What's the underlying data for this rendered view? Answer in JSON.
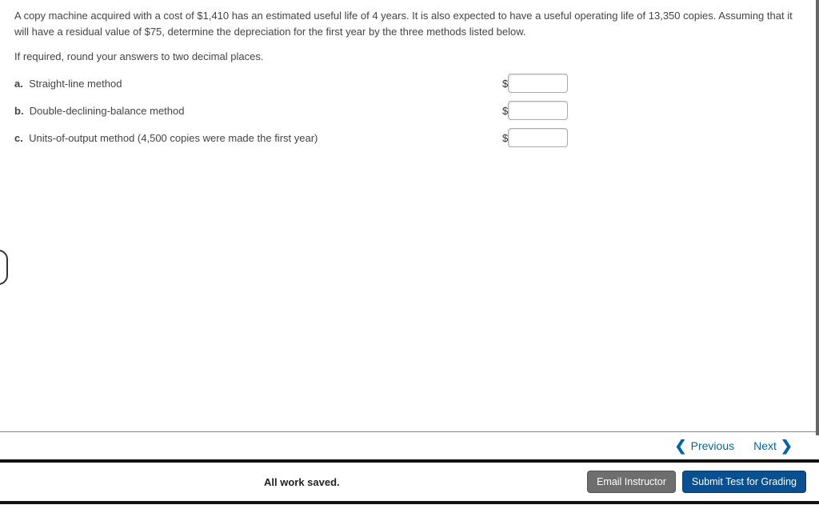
{
  "problem": "A copy machine acquired with a cost of $1,410 has an estimated useful life of 4 years. It is also expected to have a useful operating life of 13,350 copies. Assuming that it will have a residual value of $75, determine the depreciation for the first year by the three methods listed below.",
  "instruction": "If required, round your answers to two decimal places.",
  "questions": {
    "a": {
      "letter": "a.",
      "text": "Straight-line method"
    },
    "b": {
      "letter": "b.",
      "text": "Double-declining-balance method"
    },
    "c": {
      "letter": "c.",
      "text": "Units-of-output method (4,500 copies were made the first year)"
    }
  },
  "currency": "$",
  "nav": {
    "previous": "Previous",
    "next": "Next"
  },
  "footer": {
    "saved": "All work saved.",
    "email": "Email Instructor",
    "submit": "Submit Test for Grading"
  }
}
